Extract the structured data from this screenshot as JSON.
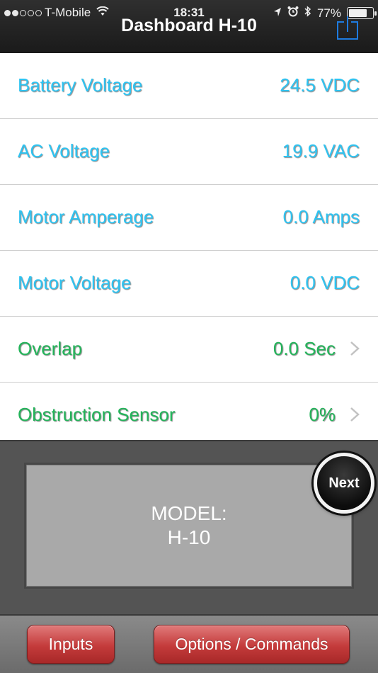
{
  "status_bar": {
    "carrier": "T-Mobile",
    "time": "18:31",
    "battery": "77%",
    "battery_level": 0.77
  },
  "header": {
    "title": "Dashboard H-10",
    "share_icon": "share-icon"
  },
  "readings": [
    {
      "label": "Battery Voltage",
      "value": "24.5 VDC",
      "color": "#2ec3f1",
      "has_chevron": false
    },
    {
      "label": "AC Voltage",
      "value": "19.9 VAC",
      "color": "#2ec3f1",
      "has_chevron": false
    },
    {
      "label": "Motor Amperage",
      "value": "0.0 Amps",
      "color": "#2ec3f1",
      "has_chevron": false
    },
    {
      "label": "Motor Voltage",
      "value": "0.0 VDC",
      "color": "#2ec3f1",
      "has_chevron": false
    },
    {
      "label": "Overlap",
      "value": "0.0 Sec",
      "color": "#23b45a",
      "has_chevron": true
    },
    {
      "label": "Obstruction Sensor",
      "value": "0%",
      "color": "#23b45a",
      "has_chevron": true
    }
  ],
  "display": {
    "line1": "MODEL:",
    "line2": "H-10",
    "next_label": "Next"
  },
  "bottom_bar": {
    "inputs_label": "Inputs",
    "options_label": "Options / Commands"
  },
  "colors": {
    "accent_blue": "#2ec3f1",
    "accent_green": "#23b45a",
    "button_red": "#c43b3b",
    "share_icon": "#1e7be0"
  }
}
